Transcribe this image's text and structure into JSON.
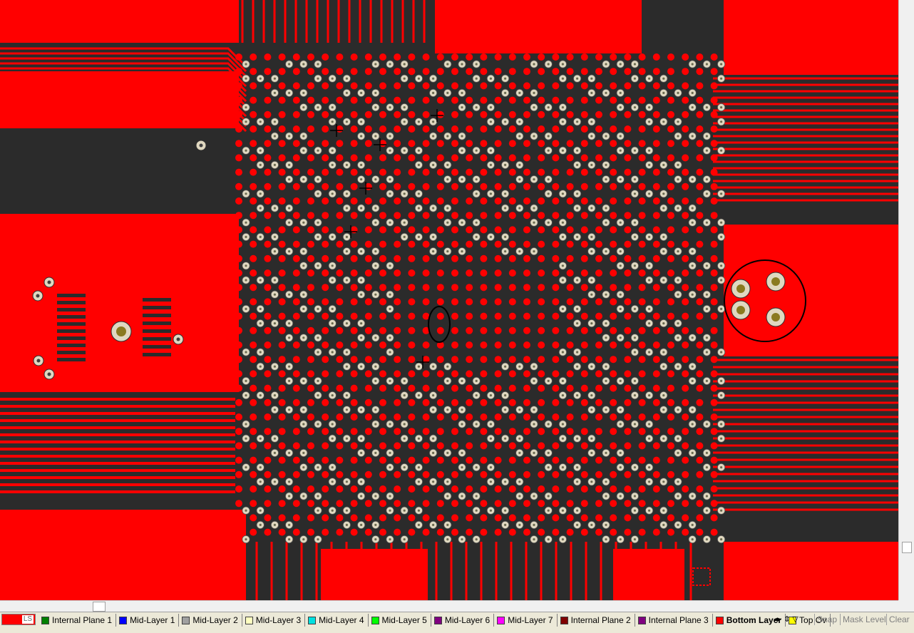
{
  "window": {
    "title": ""
  },
  "colors": {
    "background": "#2b2b2b",
    "copper": "#ff0000",
    "pad_drill": "#c8c0a0",
    "via_ring": "#e0d8c0",
    "marker": "#000000"
  },
  "layer_bar": {
    "ls_label": "LS",
    "layers": [
      {
        "label": "Internal Plane 1",
        "color": "#008000"
      },
      {
        "label": "Mid-Layer 1",
        "color": "#0000ff"
      },
      {
        "label": "Mid-Layer 2",
        "color": "#a0a0a0"
      },
      {
        "label": "Mid-Layer 3",
        "color": "#ffffc0"
      },
      {
        "label": "Mid-Layer 4",
        "color": "#00e0e0"
      },
      {
        "label": "Mid-Layer 5",
        "color": "#00ff00"
      },
      {
        "label": "Mid-Layer 6",
        "color": "#800080"
      },
      {
        "label": "Mid-Layer 7",
        "color": "#ff00ff"
      },
      {
        "label": "Internal Plane 2",
        "color": "#800000"
      },
      {
        "label": "Internal Plane 3",
        "color": "#800080"
      },
      {
        "label": "Bottom Layer",
        "color": "#ff0000",
        "active": true
      },
      {
        "label": "Top Ov",
        "color": "#ffff00"
      }
    ],
    "snap_label": "Snap",
    "mask_label": "Mask Level",
    "clear_label": "Clear"
  }
}
